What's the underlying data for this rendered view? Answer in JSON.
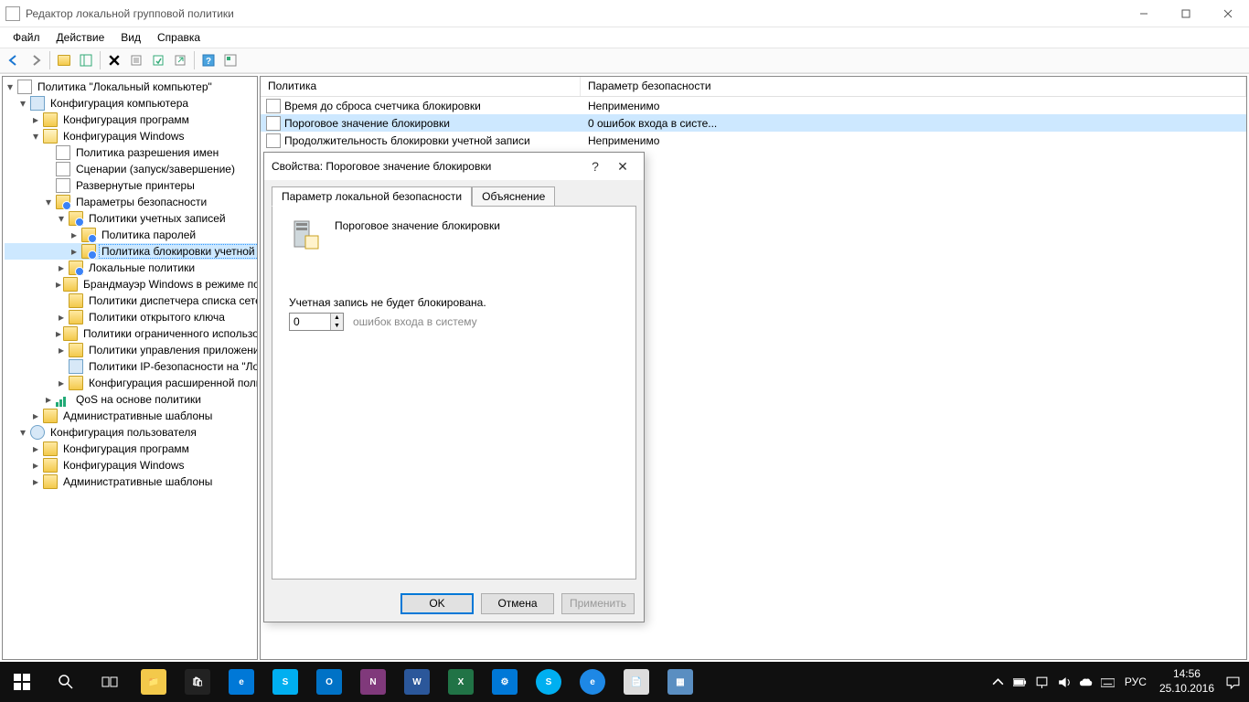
{
  "window": {
    "title": "Редактор локальной групповой политики"
  },
  "menu": {
    "file": "Файл",
    "action": "Действие",
    "view": "Вид",
    "help": "Справка"
  },
  "tree": {
    "root": "Политика \"Локальный компьютер\"",
    "comp_config": "Конфигурация компьютера",
    "prog_config": "Конфигурация программ",
    "win_config": "Конфигурация Windows",
    "name_res": "Политика разрешения имен",
    "scripts": "Сценарии (запуск/завершение)",
    "printers": "Развернутые принтеры",
    "sec_params": "Параметры безопасности",
    "acct_policies": "Политики учетных записей",
    "pwd_policy": "Политика паролей",
    "lockout_policy": "Политика блокировки учетной записи",
    "local_policies": "Локальные политики",
    "firewall": "Брандмауэр Windows в режиме повышенной безопасности",
    "nlm": "Политики диспетчера списка сетей",
    "pubkey": "Политики открытого ключа",
    "software_restrict": "Политики ограниченного использования программ",
    "app_control": "Политики управления приложениями",
    "ipsec": "Политики IP-безопасности на \"Локальный компьютер\"",
    "adv_audit": "Конфигурация расширенной политики аудита",
    "qos": "QoS на основе политики",
    "admin_templates": "Административные шаблоны",
    "user_config": "Конфигурация пользователя",
    "u_prog": "Конфигурация программ",
    "u_win": "Конфигурация Windows",
    "u_admin": "Административные шаблоны"
  },
  "list": {
    "col_policy": "Политика",
    "col_param": "Параметр безопасности",
    "rows": [
      {
        "policy": "Время до сброса счетчика блокировки",
        "param": "Неприменимо"
      },
      {
        "policy": "Пороговое значение блокировки",
        "param": "0 ошибок входа в систе..."
      },
      {
        "policy": "Продолжительность блокировки учетной записи",
        "param": "Неприменимо"
      }
    ]
  },
  "dialog": {
    "title": "Свойства: Пороговое значение блокировки",
    "tab_local": "Параметр локальной безопасности",
    "tab_explain": "Объяснение",
    "caption": "Пороговое значение блокировки",
    "message": "Учетная запись не будет блокирована.",
    "value": "0",
    "hint": "ошибок входа в систему",
    "ok": "OK",
    "cancel": "Отмена",
    "apply": "Применить"
  },
  "taskbar": {
    "lang": "РУС",
    "time": "14:56",
    "date": "25.10.2016"
  }
}
